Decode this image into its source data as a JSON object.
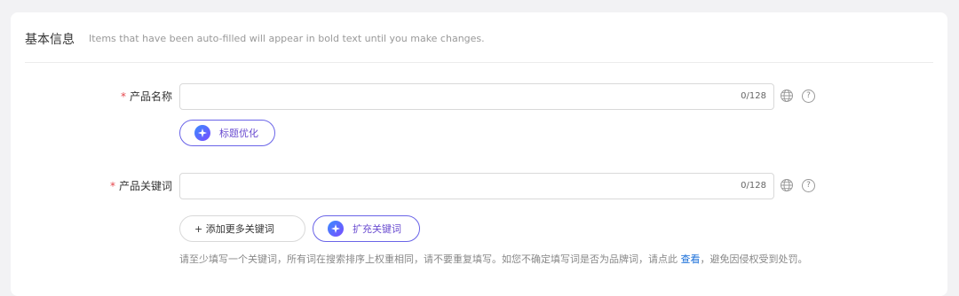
{
  "section": {
    "title": "基本信息",
    "hint": "Items that have been auto-filled will appear in bold text until you make changes."
  },
  "product_name": {
    "required_mark": "*",
    "label": "产品名称",
    "value": "",
    "counter": "0/128",
    "ai_button": "标题优化"
  },
  "product_keyword": {
    "required_mark": "*",
    "label": "产品关键词",
    "value": "",
    "counter": "0/128",
    "add_more_button": "+ 添加更多关键词",
    "ai_button": "扩充关键词"
  },
  "tip": {
    "before_link": "请至少填写一个关键词，所有词在搜索排序上权重相同，请不要重复填写。如您不确定填写词是否为品牌词，请点此 ",
    "link": "查看",
    "after_link": "，避免因侵权受到处罚。"
  },
  "icons": {
    "globe": "globe-icon",
    "help": "help-icon",
    "ai": "sparkle-icon"
  },
  "colors": {
    "required": "#e5484d",
    "accent": "#6a64e8",
    "link": "#1a6fd9"
  }
}
